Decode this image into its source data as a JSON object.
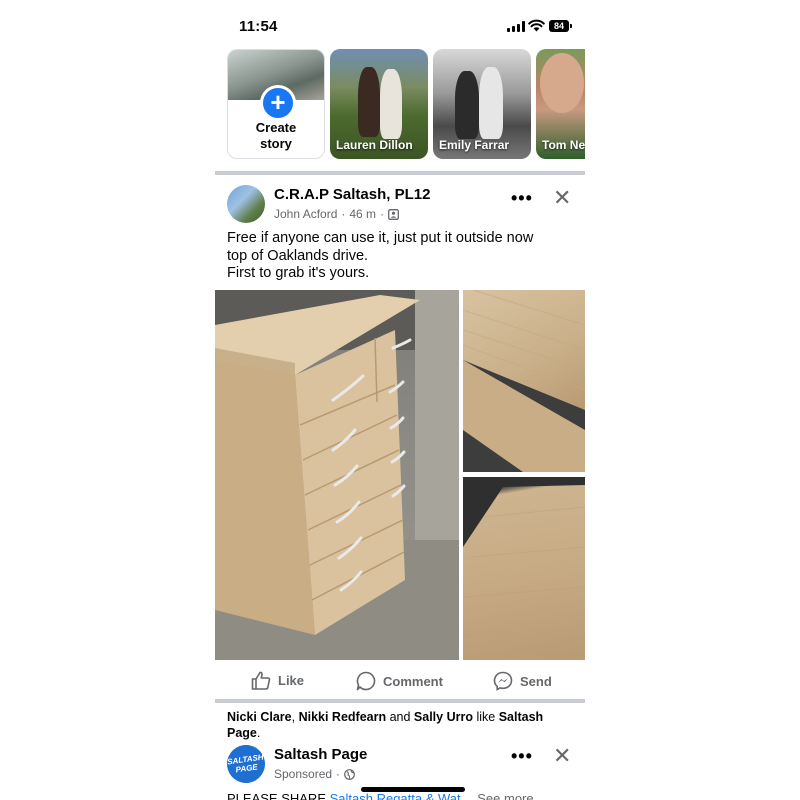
{
  "status_bar": {
    "time": "11:54",
    "battery": "84"
  },
  "stories": {
    "create_label_line1": "Create",
    "create_label_line2": "story",
    "items": [
      {
        "name": "Lauren Dillon"
      },
      {
        "name": "Emily Farrar"
      },
      {
        "name": "Tom Ne"
      }
    ]
  },
  "post": {
    "group_name": "C.R.A.P Saltash, PL12",
    "author": "John Acford",
    "time_ago": "46 m",
    "text_lines": [
      "Free if anyone can use it, just put it outside now",
      "top of Oaklands drive.",
      "First to grab it's yours."
    ],
    "actions": {
      "like": "Like",
      "comment": "Comment",
      "send": "Send"
    }
  },
  "social_context": {
    "user1": "Nicki Clare",
    "sep1": ", ",
    "user2": "Nikki Redfearn",
    "sep2": " and ",
    "user3": "Sally Urro",
    "verb": " like ",
    "page": "Saltash Page",
    "end": "."
  },
  "sponsored_post": {
    "avatar_text": "SALTASH PAGE",
    "page_name": "Saltash Page",
    "sponsored_label": "Sponsored",
    "text_start": "PLEASE SHARE ",
    "text_link": "Saltash Regatta & Wat",
    "text_more": "… See more"
  },
  "colors": {
    "accent": "#1877f2",
    "muted": "#65676b",
    "separator": "#c9ccd1"
  }
}
